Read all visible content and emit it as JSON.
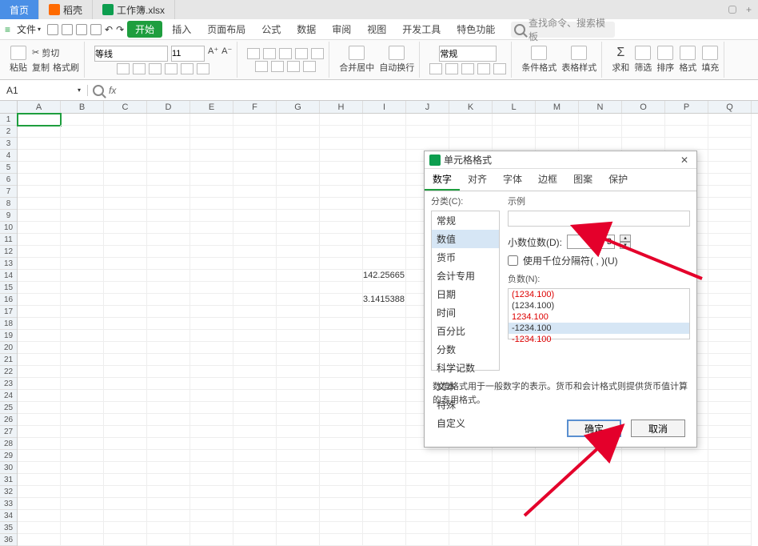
{
  "tabs": {
    "home": "首页",
    "wps": "稻壳",
    "doc": "工作簿.xlsx"
  },
  "menubar": {
    "file": "文件",
    "items": [
      "插入",
      "页面布局",
      "公式",
      "数据",
      "审阅",
      "视图",
      "开发工具",
      "特色功能"
    ],
    "begin": "开始",
    "search_placeholder": "查找命令、搜索模板"
  },
  "ribbon": {
    "paste": "粘贴",
    "cut": "剪切",
    "copy": "复制",
    "format_painter": "格式刷",
    "font_name": "等线",
    "font_size": "11",
    "merge": "合并居中",
    "wrap": "自动换行",
    "number_format": "常规",
    "cond_format": "条件格式",
    "table_style": "表格样式",
    "sum": "求和",
    "filter": "筛选",
    "sort": "排序",
    "format": "格式",
    "fill": "填充"
  },
  "namebox": {
    "ref": "A1"
  },
  "columns": [
    "A",
    "B",
    "C",
    "D",
    "E",
    "F",
    "G",
    "H",
    "I",
    "J",
    "K",
    "L",
    "M",
    "N",
    "O",
    "P",
    "Q"
  ],
  "row_count": 36,
  "cells": {
    "I14": "142.25665",
    "I16": "3.1415388"
  },
  "dialog": {
    "title": "单元格格式",
    "tabs": [
      "数字",
      "对齐",
      "字体",
      "边框",
      "图案",
      "保护"
    ],
    "category_label": "分类(C):",
    "categories": [
      "常规",
      "数值",
      "货币",
      "会计专用",
      "日期",
      "时间",
      "百分比",
      "分数",
      "科学记数",
      "文本",
      "特殊",
      "自定义"
    ],
    "selected_category": "数值",
    "sample_label": "示例",
    "decimal_label": "小数位数(D):",
    "decimal_value": "3",
    "thousands_label": "使用千位分隔符( , )(U)",
    "negative_label": "负数(N):",
    "negative_options": [
      {
        "text": "(1234.100)",
        "red": true
      },
      {
        "text": "(1234.100)",
        "red": false
      },
      {
        "text": "1234.100",
        "red": true
      },
      {
        "text": "-1234.100",
        "red": false,
        "selected": true
      },
      {
        "text": "-1234.100",
        "red": true
      }
    ],
    "description": "数值格式用于一般数字的表示。货币和会计格式则提供货币值计算的专用格式。",
    "ok": "确定",
    "cancel": "取消"
  }
}
